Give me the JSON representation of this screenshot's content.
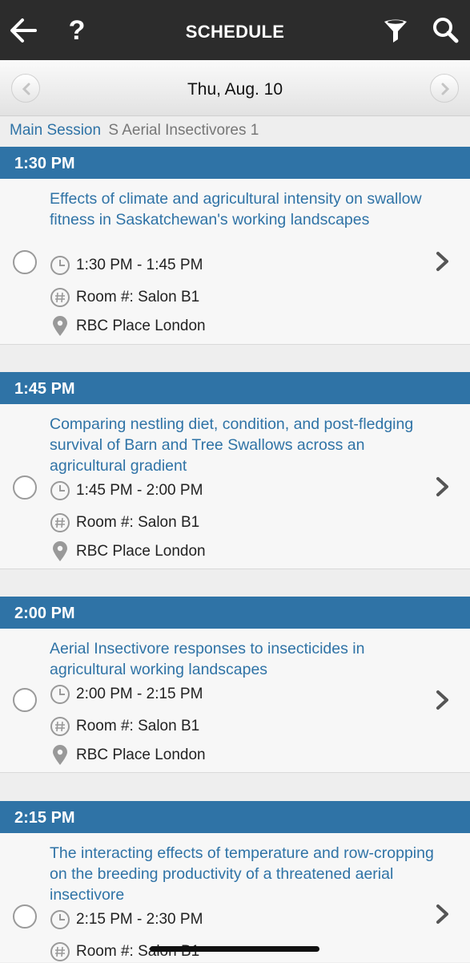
{
  "header": {
    "title": "SCHEDULE",
    "help_glyph": "?",
    "back_icon": "arrow-left-icon",
    "filter_icon": "funnel-icon",
    "search_icon": "magnifier-icon"
  },
  "date_nav": {
    "date": "Thu, Aug. 10",
    "prev_icon": "chevron-left-icon",
    "next_icon": "chevron-right-icon"
  },
  "breadcrumb": {
    "session": "Main Session",
    "track": "S Aerial Insectivores 1"
  },
  "colors": {
    "accent": "#2f73a6",
    "topbar": "#2c2c2c"
  },
  "slots": [
    {
      "time_header": "1:30 PM",
      "title": "Effects of climate and agricultural intensity on swallow fitness in Saskatchewan's working landscapes",
      "time_range": "1:30 PM - 1:45 PM",
      "room": "Room #: Salon B1",
      "location": "RBC Place London"
    },
    {
      "time_header": "1:45 PM",
      "title": "Comparing nestling diet, condition, and post-fledging survival of Barn and Tree Swallows across an agricultural gradient",
      "time_range": "1:45 PM - 2:00 PM",
      "room": "Room #: Salon B1",
      "location": "RBC Place London"
    },
    {
      "time_header": "2:00 PM",
      "title": "Aerial Insectivore responses to insecticides in agricultural working landscapes",
      "time_range": "2:00 PM - 2:15 PM",
      "room": "Room #: Salon B1",
      "location": "RBC Place London"
    },
    {
      "time_header": "2:15 PM",
      "title": "The interacting effects of temperature and row-cropping on the breeding productivity of a threatened aerial insectivore",
      "time_range": "2:15 PM - 2:30 PM",
      "room": "Room #: Salon B1",
      "location": ""
    }
  ]
}
